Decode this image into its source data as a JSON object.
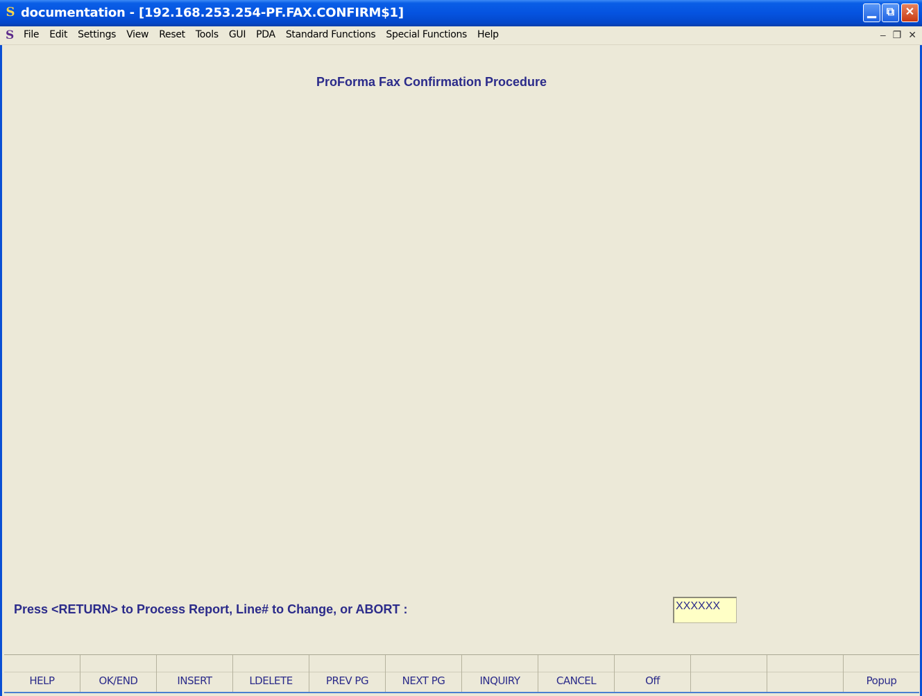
{
  "window": {
    "title": "documentation - [192.168.253.254-PF.FAX.CONFIRM$1]",
    "app_icon": "S",
    "buttons": [
      "minimize",
      "restore",
      "close"
    ]
  },
  "menubar": {
    "logo": "S",
    "items": [
      "File",
      "Edit",
      "Settings",
      "View",
      "Reset",
      "Tools",
      "GUI",
      "PDA",
      "Standard Functions",
      "Special Functions",
      "Help"
    ],
    "mdi_controls": [
      "_",
      "`",
      "✕"
    ]
  },
  "screen": {
    "title": "ProForma Fax Confirmation Procedure",
    "prompt": "Press <RETURN> to Process Report, Line# to Change, or ABORT :",
    "input_value": "XXXXXX"
  },
  "function_keys": [
    "HELP",
    "OK/END",
    "INSERT",
    "LDELETE",
    "PREV PG",
    "NEXT PG",
    "INQUIRY",
    "CANCEL",
    "Off",
    "",
    "",
    "Popup"
  ]
}
